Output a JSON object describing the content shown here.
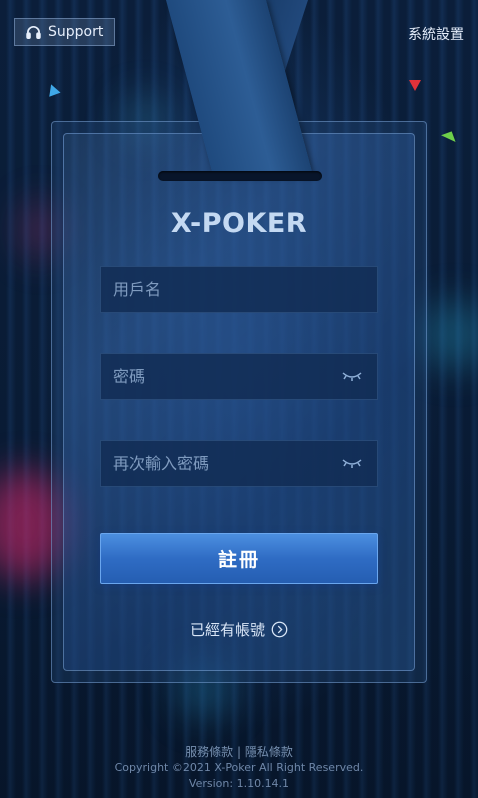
{
  "header": {
    "support_label": "Support",
    "settings_label": "系統設置"
  },
  "logo": {
    "text": "X-POKER"
  },
  "form": {
    "username_placeholder": "用戶名",
    "password_placeholder": "密碼",
    "confirm_password_placeholder": "再次輸入密碼",
    "register_label": "註冊",
    "have_account_label": "已經有帳號"
  },
  "footer": {
    "terms_label": "服務條款",
    "separator": "|",
    "privacy_label": "隱私條款",
    "copyright": "Copyright ©2021 X-Poker All Right Reserved.",
    "version": "Version: 1.10.14.1"
  },
  "colors": {
    "background": "#0a1a33",
    "button": "#2f6cc4",
    "text": "#cfe0f5"
  }
}
